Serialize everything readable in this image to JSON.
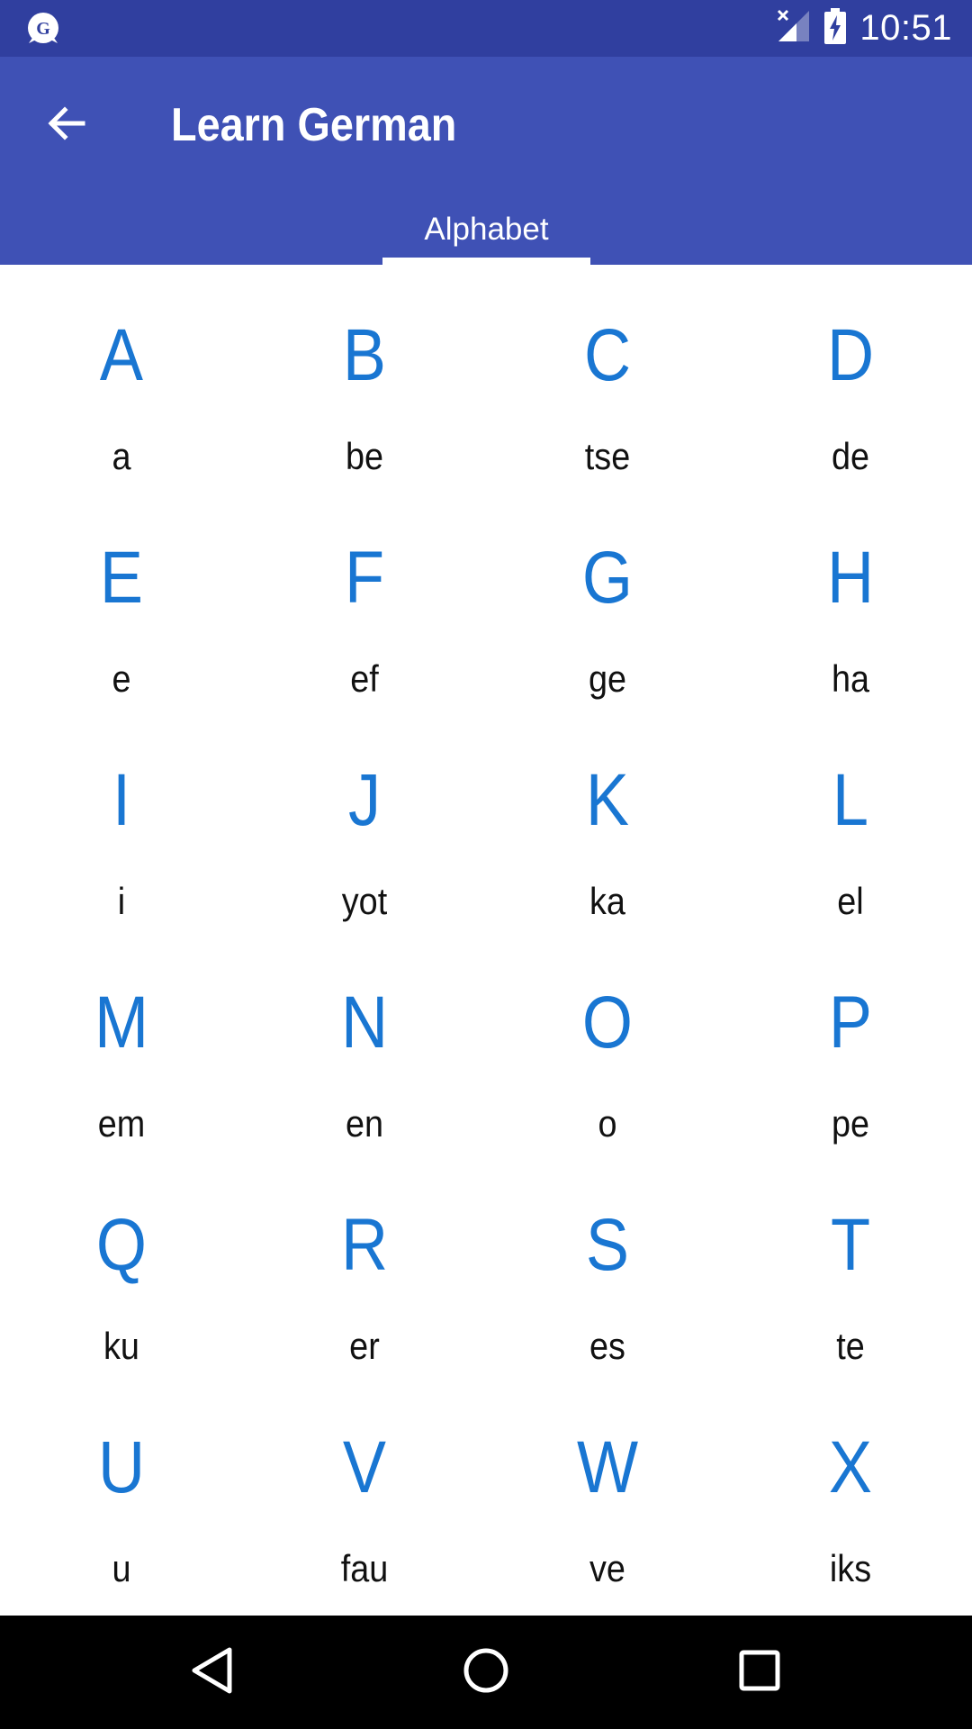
{
  "status_bar": {
    "app_icon": "g-badge-icon",
    "app_icon_letter": "G",
    "signal_icon": "signal-no-data-icon",
    "battery_icon": "battery-charging-icon",
    "time": "10:51"
  },
  "app_bar": {
    "back_icon": "arrow-back-icon",
    "title": "Learn German",
    "tabs": [
      {
        "label": "Alphabet",
        "selected": true
      }
    ]
  },
  "alphabet": [
    {
      "letter": "A",
      "pronunciation": "a"
    },
    {
      "letter": "B",
      "pronunciation": "be"
    },
    {
      "letter": "C",
      "pronunciation": "tse"
    },
    {
      "letter": "D",
      "pronunciation": "de"
    },
    {
      "letter": "E",
      "pronunciation": "e"
    },
    {
      "letter": "F",
      "pronunciation": "ef"
    },
    {
      "letter": "G",
      "pronunciation": "ge"
    },
    {
      "letter": "H",
      "pronunciation": "ha"
    },
    {
      "letter": "I",
      "pronunciation": "i"
    },
    {
      "letter": "J",
      "pronunciation": "yot"
    },
    {
      "letter": "K",
      "pronunciation": "ka"
    },
    {
      "letter": "L",
      "pronunciation": "el"
    },
    {
      "letter": "M",
      "pronunciation": "em"
    },
    {
      "letter": "N",
      "pronunciation": "en"
    },
    {
      "letter": "O",
      "pronunciation": "o"
    },
    {
      "letter": "P",
      "pronunciation": "pe"
    },
    {
      "letter": "Q",
      "pronunciation": "ku"
    },
    {
      "letter": "R",
      "pronunciation": "er"
    },
    {
      "letter": "S",
      "pronunciation": "es"
    },
    {
      "letter": "T",
      "pronunciation": "te"
    },
    {
      "letter": "U",
      "pronunciation": "u"
    },
    {
      "letter": "V",
      "pronunciation": "fau"
    },
    {
      "letter": "W",
      "pronunciation": "ve"
    },
    {
      "letter": "X",
      "pronunciation": "iks"
    }
  ],
  "nav_bar": {
    "back_icon": "nav-back-triangle-icon",
    "home_icon": "nav-home-circle-icon",
    "recents_icon": "nav-recents-square-icon"
  },
  "colors": {
    "status_bar": "#303f9f",
    "app_bar": "#3f51b5",
    "letter": "#1976d2",
    "pronunciation": "#111111",
    "nav_bar": "#000000"
  }
}
